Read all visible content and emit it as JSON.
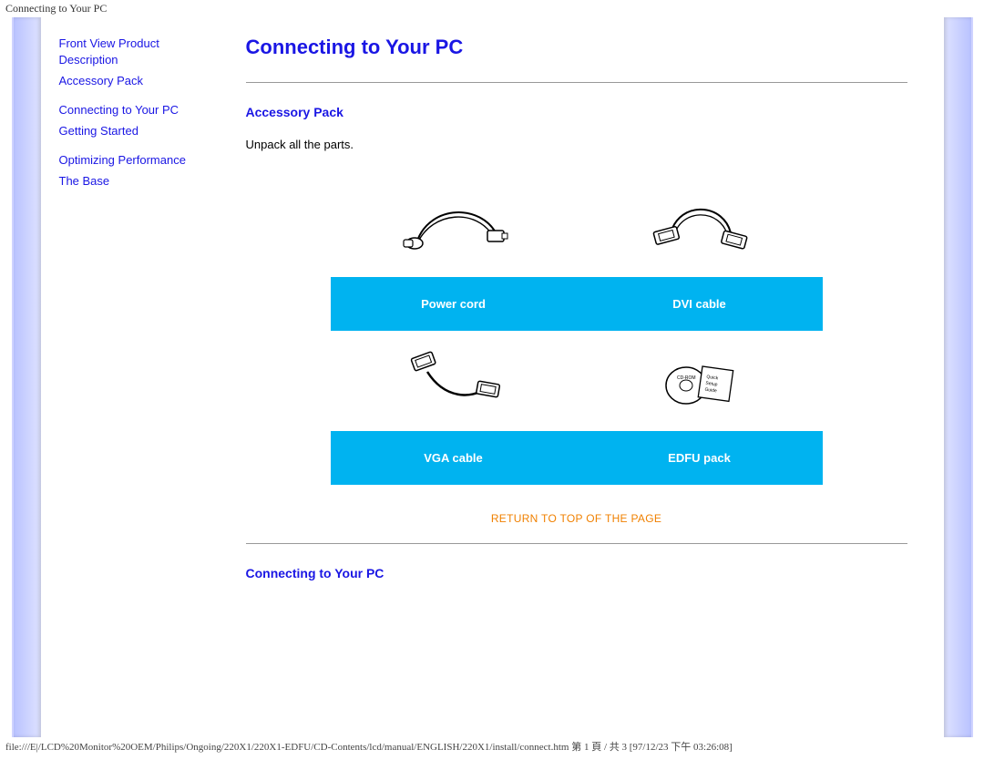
{
  "browser_title": "Connecting to Your PC",
  "sidebar": {
    "items": [
      {
        "label": "Front View Product Description"
      },
      {
        "label": "Accessory Pack"
      },
      {
        "label": "Connecting to Your PC"
      },
      {
        "label": "Getting Started"
      },
      {
        "label": "Optimizing Performance"
      },
      {
        "label": "The Base"
      }
    ]
  },
  "main": {
    "title": "Connecting to Your PC",
    "section_accessory": {
      "heading": "Accessory Pack",
      "instruction": "Unpack all the parts.",
      "items": [
        {
          "label": "Power cord"
        },
        {
          "label": "DVI cable"
        },
        {
          "label": "VGA cable"
        },
        {
          "label": "EDFU pack"
        }
      ]
    },
    "return_link": "RETURN TO TOP OF THE PAGE",
    "section_connect_heading": "Connecting to Your PC"
  },
  "footer": "file:///E|/LCD%20Monitor%20OEM/Philips/Ongoing/220X1/220X1-EDFU/CD-Contents/lcd/manual/ENGLISH/220X1/install/connect.htm 第 1 頁 / 共 3  [97/12/23 下午 03:26:08]"
}
